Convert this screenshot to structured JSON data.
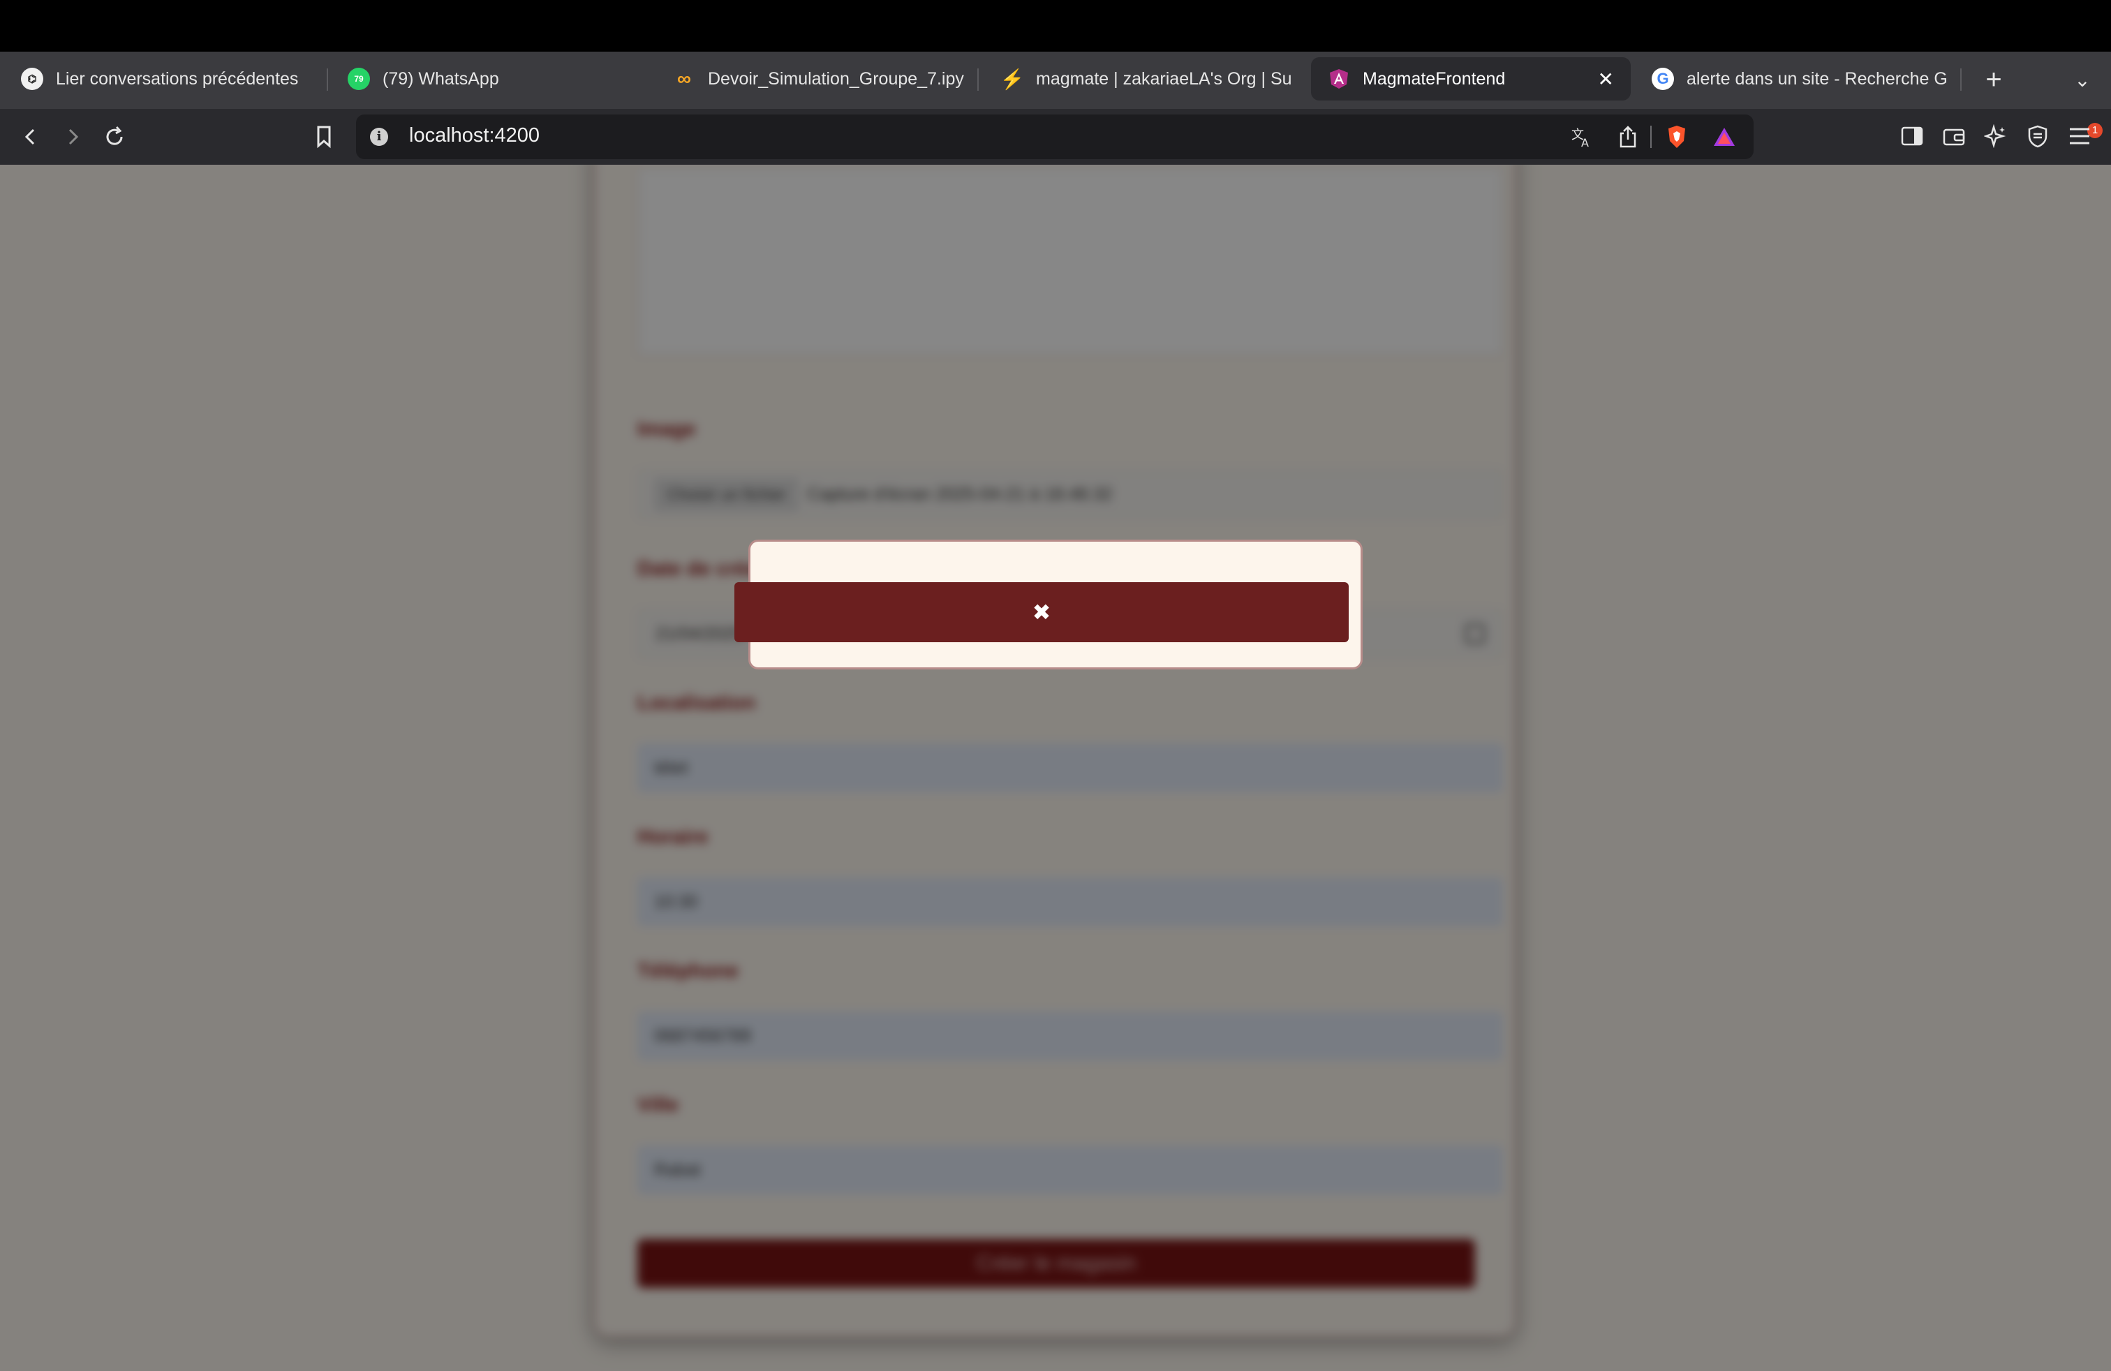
{
  "browser": {
    "tabs": [
      {
        "title": "Lier conversations précédentes",
        "icon": "openai-icon",
        "active": false
      },
      {
        "title": "(79) WhatsApp",
        "icon": "whatsapp-icon",
        "active": false
      },
      {
        "title": "Devoir_Simulation_Groupe_7.ipy",
        "icon": "colab-icon",
        "active": false
      },
      {
        "title": "magmate | zakariaeLA's Org | Su",
        "icon": "supabase-icon",
        "active": false
      },
      {
        "title": "MagmateFrontend",
        "icon": "angular-icon",
        "active": true
      },
      {
        "title": "alerte dans un site - Recherche G",
        "icon": "google-icon",
        "active": false
      }
    ],
    "url": "localhost:4200",
    "brave_badge": "1",
    "whatsapp_badge": "79",
    "close_tab_glyph": "✕",
    "new_tab_glyph": "+",
    "tab_menu_glyph": "⌄"
  },
  "form": {
    "image_label": "Image",
    "file_button": "Choisir un fichier",
    "file_name": "Capture d'écran 2025-04-21 à 18.48.32",
    "date_label": "Date de création",
    "date_value": "21/04/2025",
    "location_label": "Localisation",
    "location_value": "tétet",
    "hours_label": "Horaire",
    "hours_value": "10:30",
    "phone_label": "Téléphone",
    "phone_value": "0687456789",
    "city_label": "Ville",
    "city_value": "Rabat",
    "submit_label": "Créer le magasin"
  },
  "modal": {
    "close_glyph": "✖"
  },
  "colors": {
    "accent": "#6b1f1f",
    "modal_bg": "#fdf5ec",
    "chrome_bg": "#2a2a2e"
  }
}
